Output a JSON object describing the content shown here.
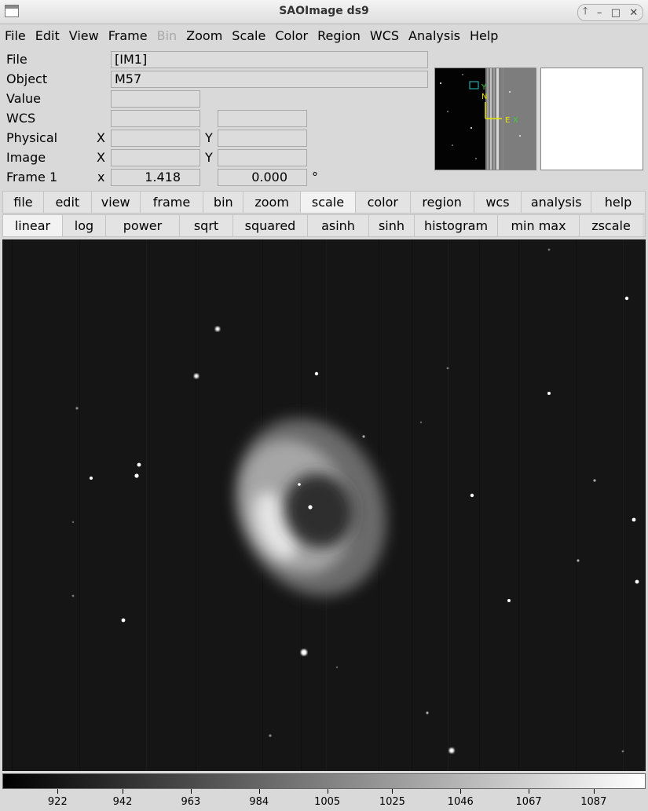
{
  "window": {
    "title": "SAOImage ds9",
    "controls": [
      "🡑",
      "–",
      "□",
      "✕"
    ]
  },
  "menubar": [
    {
      "label": "File",
      "enabled": true
    },
    {
      "label": "Edit",
      "enabled": true
    },
    {
      "label": "View",
      "enabled": true
    },
    {
      "label": "Frame",
      "enabled": true
    },
    {
      "label": "Bin",
      "enabled": false
    },
    {
      "label": "Zoom",
      "enabled": true
    },
    {
      "label": "Scale",
      "enabled": true
    },
    {
      "label": "Color",
      "enabled": true
    },
    {
      "label": "Region",
      "enabled": true
    },
    {
      "label": "WCS",
      "enabled": true
    },
    {
      "label": "Analysis",
      "enabled": true
    },
    {
      "label": "Help",
      "enabled": true
    }
  ],
  "info": {
    "file_label": "File",
    "file_value": "[IM1]",
    "object_label": "Object",
    "object_value": "M57",
    "value_label": "Value",
    "value_value": "",
    "wcs_label": "WCS",
    "physical_label": "Physical",
    "image_label": "Image",
    "frame_label": "Frame 1",
    "x_label": "X",
    "y_label": "Y",
    "x_lower": "x",
    "zoom_value": "1.418",
    "angle_value": "0.000",
    "degree": "°"
  },
  "panner": {
    "labels": {
      "n": "N",
      "e": "E",
      "x": "X",
      "y": "Y"
    }
  },
  "buttonbar": [
    {
      "label": "file"
    },
    {
      "label": "edit"
    },
    {
      "label": "view"
    },
    {
      "label": "frame"
    },
    {
      "label": "bin"
    },
    {
      "label": "zoom"
    },
    {
      "label": "scale",
      "active": true
    },
    {
      "label": "color"
    },
    {
      "label": "region"
    },
    {
      "label": "wcs"
    },
    {
      "label": "analysis"
    },
    {
      "label": "help"
    }
  ],
  "scalebar": [
    {
      "label": "linear",
      "active": true
    },
    {
      "label": "log"
    },
    {
      "label": "power"
    },
    {
      "label": "sqrt"
    },
    {
      "label": "squared"
    },
    {
      "label": "asinh"
    },
    {
      "label": "sinh"
    },
    {
      "label": "histogram"
    },
    {
      "label": "min max"
    },
    {
      "label": "zscale"
    }
  ],
  "colorbar": {
    "min": 905,
    "max": 1103,
    "ticks": [
      "922",
      "942",
      "963",
      "984",
      "1005",
      "1025",
      "1046",
      "1067",
      "1087"
    ]
  }
}
